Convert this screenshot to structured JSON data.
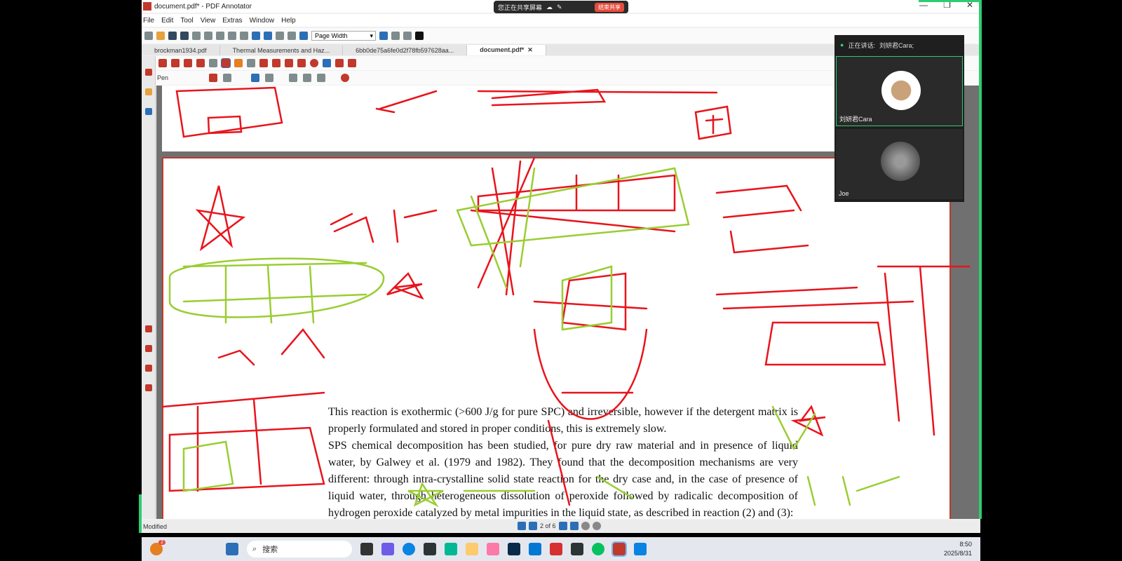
{
  "window": {
    "title": "document.pdf* - PDF Annotator"
  },
  "share_bar": {
    "text": "您正在共享屏幕",
    "end_label": "结束共享"
  },
  "menu": [
    "File",
    "Edit",
    "Tool",
    "View",
    "Extras",
    "Window",
    "Help"
  ],
  "toolbar": {
    "zoom_value": "Page Width",
    "tool_name": "Pen"
  },
  "tabs": [
    {
      "label": "brockman1934.pdf"
    },
    {
      "label": "Thermal Measurements and Haz..."
    },
    {
      "label": "6bb0de75a6fe0d2f78fb597628aa..."
    },
    {
      "label": "document.pdf*"
    }
  ],
  "document": {
    "paragraph1": "This reaction is exothermic (>600 J/g for pure SPC) and irreversible, however if the detergent matrix is properly formulated and stored in proper conditions, this is extremely slow.",
    "paragraph2": "SPS chemical decomposition has been studied, for pure dry raw material and in presence of liquid water, by Galwey et al. (1979 and 1982). They found that the decomposition mechanisms are very different: through intra-crystalline solid state reaction for the dry case and, in the case of presence of liquid water, through heterogeneous dissolution of peroxide followed by radicalic decomposition of hydrogen peroxide catalyzed by metal impurities in the liquid state, as described in reaction (2) and (3):"
  },
  "status": {
    "left": "Modified",
    "page_indicator": "2 of 6"
  },
  "meeting": {
    "speaking_label": "正在讲话:",
    "speaker": "刘妍君Cara;",
    "participants": [
      {
        "name": "刘妍君Cara"
      },
      {
        "name": "Joe"
      }
    ]
  },
  "taskbar": {
    "search_placeholder": "搜索",
    "time": "8:50",
    "date": "2025/8/31",
    "notification_count": "2"
  },
  "colors": {
    "ink_red": "#e8141c",
    "ink_green": "#9acd32",
    "accent_green": "#2ecc71"
  }
}
